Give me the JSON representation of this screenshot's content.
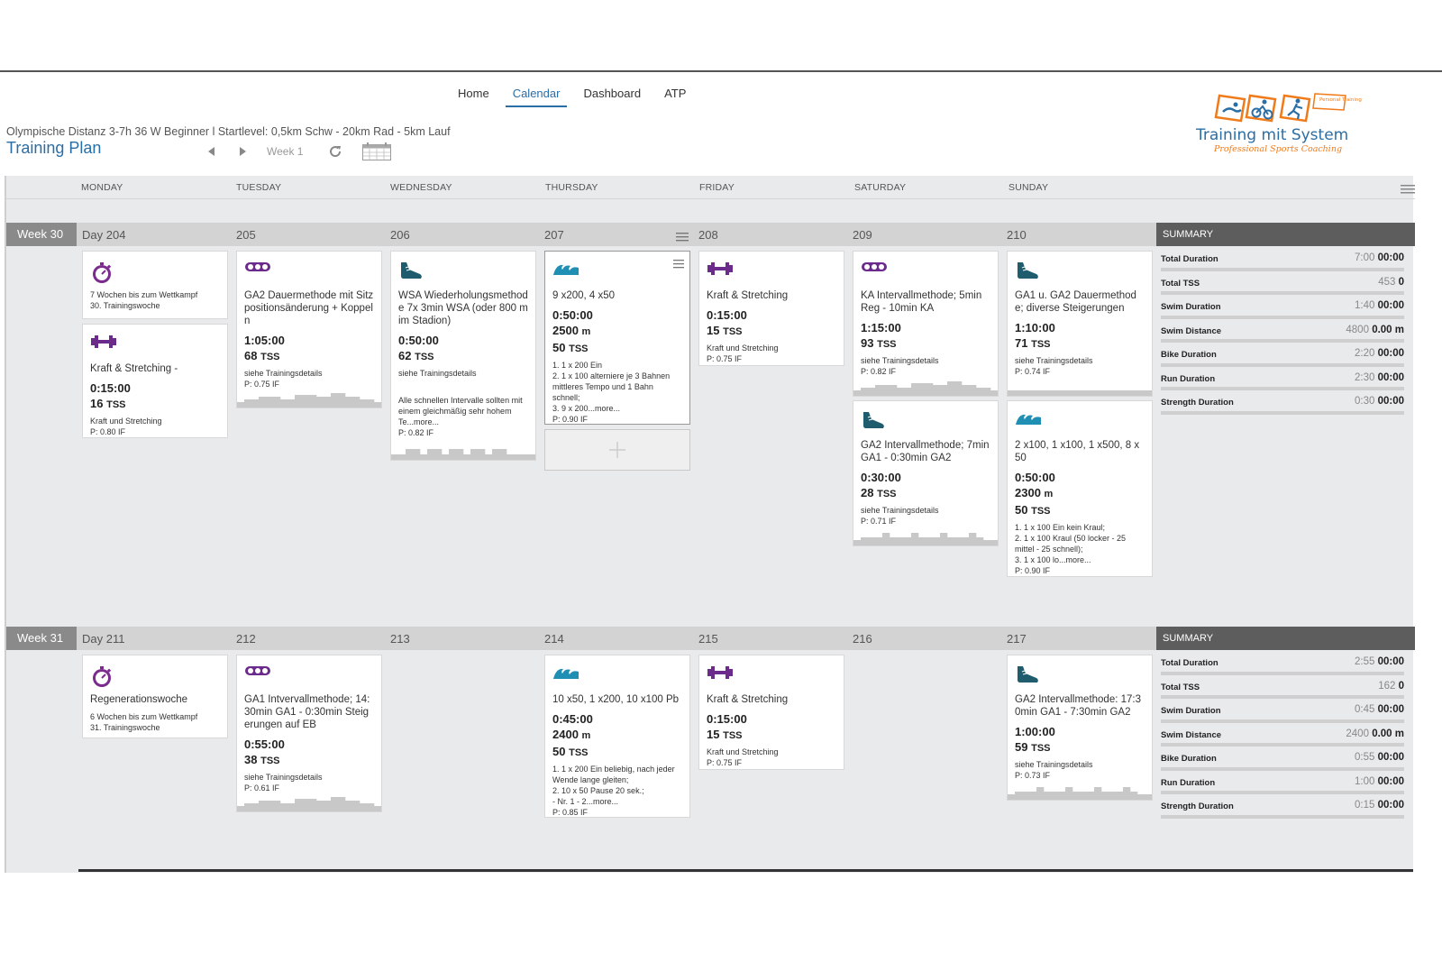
{
  "nav": {
    "items": [
      "Home",
      "Calendar",
      "Dashboard",
      "ATP"
    ],
    "active": 1
  },
  "plan": {
    "subtitle": "Olympische Distanz 3-7h 36 W Beginner l Startlevel: 0,5km Schw - 20km Rad - 5km Lauf",
    "title": "Training Plan",
    "week_label": "Week 1"
  },
  "logo": {
    "name": "Training mit System",
    "tagline": "Professional Sports Coaching",
    "badge": "Personal Training"
  },
  "days": [
    "MONDAY",
    "TUESDAY",
    "WEDNESDAY",
    "THURSDAY",
    "FRIDAY",
    "SATURDAY",
    "SUNDAY"
  ],
  "summary_title": "SUMMARY",
  "weeks": [
    {
      "label": "Week 30",
      "day_numbers": [
        "Day 204",
        "205",
        "206",
        "207",
        "208",
        "209",
        "210"
      ],
      "summary": [
        {
          "label": "Total Duration",
          "plan": "7:00",
          "actual": "00:00"
        },
        {
          "label": "Total TSS",
          "plan": "453",
          "actual": "0"
        },
        {
          "label": "Swim Duration",
          "plan": "1:40",
          "actual": "00:00"
        },
        {
          "label": "Swim Distance",
          "plan": "4800",
          "actual": "0.00 m"
        },
        {
          "label": "Bike Duration",
          "plan": "2:20",
          "actual": "00:00"
        },
        {
          "label": "Run Duration",
          "plan": "2:30",
          "actual": "00:00"
        },
        {
          "label": "Strength Duration",
          "plan": "0:30",
          "actual": "00:00"
        }
      ],
      "cards": [
        {
          "day": 0,
          "type": "event",
          "icon": "stopwatch-icon",
          "title": "",
          "note": "7 Wochen bis zum Wettkampf\n30. Trainingswoche"
        },
        {
          "day": 0,
          "type": "strength",
          "icon": "dumbbell-icon",
          "title": "Kraft & Stretching -",
          "duration": "0:15:00",
          "tss": "16",
          "desc": "Kraft und Stretching",
          "if": "P: 0.80 IF"
        },
        {
          "day": 1,
          "type": "bike",
          "icon": "bike-chain-icon",
          "title": "GA2 Dauermethode mit Sitzpositionsänderung + Koppeln",
          "duration": "1:05:00",
          "tss": "68",
          "desc": "siehe Trainingsdetails",
          "if": "P: 0.75 IF",
          "profile": true
        },
        {
          "day": 2,
          "type": "run",
          "icon": "running-shoe-icon",
          "title": "WSA Wiederholungsmethode 7x 3min WSA (oder 800 m im Stadion)",
          "duration": "0:50:00",
          "tss": "62",
          "desc": "siehe Trainingsdetails",
          "extra": "Alle schnellen Intervalle sollten mit einem gleichmäßig sehr hohem Te...more...",
          "if": "P: 0.82 IF",
          "profile": true
        },
        {
          "day": 3,
          "type": "swim",
          "icon": "swim-wave-icon",
          "title": "9 x200, 4 x50",
          "duration": "0:50:00",
          "distance": "2500",
          "tss": "50",
          "desc": "1. 1 x 200 Ein\n2. 1 x 100 alterniere je 3 Bahnen mittleres Tempo und 1 Bahn schnell;\n3. 9 x 200...more...",
          "if": "P: 0.90 IF",
          "selected": true
        },
        {
          "day": 4,
          "type": "strength",
          "icon": "dumbbell-icon",
          "title": "Kraft & Stretching",
          "duration": "0:15:00",
          "tss": "15",
          "desc": "Kraft und Stretching",
          "if": "P: 0.75 IF"
        },
        {
          "day": 5,
          "type": "bike",
          "icon": "bike-chain-icon",
          "title": "KA Intervallmethode; 5min Reg - 10min KA",
          "duration": "1:15:00",
          "tss": "93",
          "desc": "siehe Trainingsdetails",
          "if": "P: 0.82 IF",
          "profile": true
        },
        {
          "day": 5,
          "type": "run",
          "icon": "running-shoe-icon",
          "title": "GA2 Intervallmethode; 7min GA1 - 0:30min GA2",
          "duration": "0:30:00",
          "tss": "28",
          "desc": "siehe Trainingsdetails",
          "if": "P: 0.71 IF",
          "profile": true
        },
        {
          "day": 6,
          "type": "run",
          "icon": "running-shoe-icon",
          "title": "GA1 u. GA2 Dauermethode; diverse Steigerungen",
          "duration": "1:10:00",
          "tss": "71",
          "desc": "siehe Trainingsdetails",
          "if": "P: 0.74 IF",
          "profile": true
        },
        {
          "day": 6,
          "type": "swim",
          "icon": "swim-wave-icon",
          "title": "2 x100, 1 x100, 1 x500, 8 x 50",
          "duration": "0:50:00",
          "distance": "2300",
          "tss": "50",
          "desc": "1. 1 x 100 Ein kein Kraul;\n2. 1 x 100 Kraul (50 locker - 25 mittel - 25 schnell);\n3. 1 x 100 lo...more...",
          "if": "P: 0.90 IF"
        }
      ]
    },
    {
      "label": "Week 31",
      "day_numbers": [
        "Day 211",
        "212",
        "213",
        "214",
        "215",
        "216",
        "217"
      ],
      "summary": [
        {
          "label": "Total Duration",
          "plan": "2:55",
          "actual": "00:00"
        },
        {
          "label": "Total TSS",
          "plan": "162",
          "actual": "0"
        },
        {
          "label": "Swim Duration",
          "plan": "0:45",
          "actual": "00:00"
        },
        {
          "label": "Swim Distance",
          "plan": "2400",
          "actual": "0.00 m"
        },
        {
          "label": "Bike Duration",
          "plan": "0:55",
          "actual": "00:00"
        },
        {
          "label": "Run Duration",
          "plan": "1:00",
          "actual": "00:00"
        },
        {
          "label": "Strength Duration",
          "plan": "0:15",
          "actual": "00:00"
        }
      ],
      "cards": [
        {
          "day": 0,
          "type": "event",
          "icon": "stopwatch-icon",
          "title": "Regenerationswoche",
          "note": "6 Wochen bis zum Wettkampf\n31. Trainingswoche"
        },
        {
          "day": 1,
          "type": "bike",
          "icon": "bike-chain-icon",
          "title": "GA1 Intvervallmethode; 14:30min GA1 - 0:30min Steigerungen auf EB",
          "duration": "0:55:00",
          "tss": "38",
          "desc": "siehe Trainingsdetails",
          "if": "P: 0.61 IF",
          "profile": true
        },
        {
          "day": 3,
          "type": "swim",
          "icon": "swim-wave-icon",
          "title": "10 x50, 1 x200, 10 x100 Pb",
          "duration": "0:45:00",
          "distance": "2400",
          "tss": "50",
          "desc": "1. 1 x 200 Ein beliebig, nach jeder Wende lange gleiten;\n2. 10 x 50 Pause 20 sek.;\n- Nr. 1 - 2...more...",
          "if": "P: 0.85 IF"
        },
        {
          "day": 4,
          "type": "strength",
          "icon": "dumbbell-icon",
          "title": "Kraft & Stretching",
          "duration": "0:15:00",
          "tss": "15",
          "desc": "Kraft und Stretching",
          "if": "P: 0.75 IF"
        },
        {
          "day": 6,
          "type": "run",
          "icon": "running-shoe-icon",
          "title": "GA2 Intervallmethode: 17:30min GA1 - 7:30min GA2",
          "duration": "1:00:00",
          "tss": "59",
          "desc": "siehe Trainingsdetails",
          "if": "P: 0.73 IF",
          "profile": true
        }
      ]
    }
  ],
  "labels": {
    "tss_unit": "TSS",
    "distance_unit": "m"
  },
  "colors": {
    "accent": "#2a6ea6",
    "bike": "#6a2b8a",
    "run": "#1f5c6e",
    "swim": "#1f8fb3",
    "strength": "#6a2b8a",
    "event": "#7b2a8e",
    "logo_orange": "#f07b1a",
    "logo_blue": "#2a6ea6"
  }
}
